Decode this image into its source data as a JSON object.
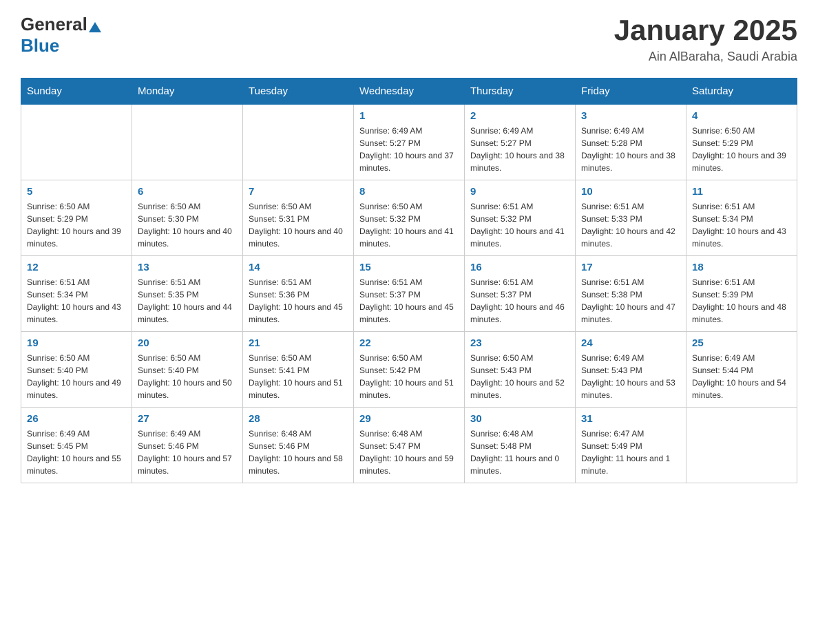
{
  "header": {
    "logo_general": "General",
    "logo_blue": "Blue",
    "month_year": "January 2025",
    "location": "Ain AlBaraha, Saudi Arabia"
  },
  "weekdays": [
    "Sunday",
    "Monday",
    "Tuesday",
    "Wednesday",
    "Thursday",
    "Friday",
    "Saturday"
  ],
  "rows": [
    [
      {
        "day": "",
        "info": ""
      },
      {
        "day": "",
        "info": ""
      },
      {
        "day": "",
        "info": ""
      },
      {
        "day": "1",
        "info": "Sunrise: 6:49 AM\nSunset: 5:27 PM\nDaylight: 10 hours and 37 minutes."
      },
      {
        "day": "2",
        "info": "Sunrise: 6:49 AM\nSunset: 5:27 PM\nDaylight: 10 hours and 38 minutes."
      },
      {
        "day": "3",
        "info": "Sunrise: 6:49 AM\nSunset: 5:28 PM\nDaylight: 10 hours and 38 minutes."
      },
      {
        "day": "4",
        "info": "Sunrise: 6:50 AM\nSunset: 5:29 PM\nDaylight: 10 hours and 39 minutes."
      }
    ],
    [
      {
        "day": "5",
        "info": "Sunrise: 6:50 AM\nSunset: 5:29 PM\nDaylight: 10 hours and 39 minutes."
      },
      {
        "day": "6",
        "info": "Sunrise: 6:50 AM\nSunset: 5:30 PM\nDaylight: 10 hours and 40 minutes."
      },
      {
        "day": "7",
        "info": "Sunrise: 6:50 AM\nSunset: 5:31 PM\nDaylight: 10 hours and 40 minutes."
      },
      {
        "day": "8",
        "info": "Sunrise: 6:50 AM\nSunset: 5:32 PM\nDaylight: 10 hours and 41 minutes."
      },
      {
        "day": "9",
        "info": "Sunrise: 6:51 AM\nSunset: 5:32 PM\nDaylight: 10 hours and 41 minutes."
      },
      {
        "day": "10",
        "info": "Sunrise: 6:51 AM\nSunset: 5:33 PM\nDaylight: 10 hours and 42 minutes."
      },
      {
        "day": "11",
        "info": "Sunrise: 6:51 AM\nSunset: 5:34 PM\nDaylight: 10 hours and 43 minutes."
      }
    ],
    [
      {
        "day": "12",
        "info": "Sunrise: 6:51 AM\nSunset: 5:34 PM\nDaylight: 10 hours and 43 minutes."
      },
      {
        "day": "13",
        "info": "Sunrise: 6:51 AM\nSunset: 5:35 PM\nDaylight: 10 hours and 44 minutes."
      },
      {
        "day": "14",
        "info": "Sunrise: 6:51 AM\nSunset: 5:36 PM\nDaylight: 10 hours and 45 minutes."
      },
      {
        "day": "15",
        "info": "Sunrise: 6:51 AM\nSunset: 5:37 PM\nDaylight: 10 hours and 45 minutes."
      },
      {
        "day": "16",
        "info": "Sunrise: 6:51 AM\nSunset: 5:37 PM\nDaylight: 10 hours and 46 minutes."
      },
      {
        "day": "17",
        "info": "Sunrise: 6:51 AM\nSunset: 5:38 PM\nDaylight: 10 hours and 47 minutes."
      },
      {
        "day": "18",
        "info": "Sunrise: 6:51 AM\nSunset: 5:39 PM\nDaylight: 10 hours and 48 minutes."
      }
    ],
    [
      {
        "day": "19",
        "info": "Sunrise: 6:50 AM\nSunset: 5:40 PM\nDaylight: 10 hours and 49 minutes."
      },
      {
        "day": "20",
        "info": "Sunrise: 6:50 AM\nSunset: 5:40 PM\nDaylight: 10 hours and 50 minutes."
      },
      {
        "day": "21",
        "info": "Sunrise: 6:50 AM\nSunset: 5:41 PM\nDaylight: 10 hours and 51 minutes."
      },
      {
        "day": "22",
        "info": "Sunrise: 6:50 AM\nSunset: 5:42 PM\nDaylight: 10 hours and 51 minutes."
      },
      {
        "day": "23",
        "info": "Sunrise: 6:50 AM\nSunset: 5:43 PM\nDaylight: 10 hours and 52 minutes."
      },
      {
        "day": "24",
        "info": "Sunrise: 6:49 AM\nSunset: 5:43 PM\nDaylight: 10 hours and 53 minutes."
      },
      {
        "day": "25",
        "info": "Sunrise: 6:49 AM\nSunset: 5:44 PM\nDaylight: 10 hours and 54 minutes."
      }
    ],
    [
      {
        "day": "26",
        "info": "Sunrise: 6:49 AM\nSunset: 5:45 PM\nDaylight: 10 hours and 55 minutes."
      },
      {
        "day": "27",
        "info": "Sunrise: 6:49 AM\nSunset: 5:46 PM\nDaylight: 10 hours and 57 minutes."
      },
      {
        "day": "28",
        "info": "Sunrise: 6:48 AM\nSunset: 5:46 PM\nDaylight: 10 hours and 58 minutes."
      },
      {
        "day": "29",
        "info": "Sunrise: 6:48 AM\nSunset: 5:47 PM\nDaylight: 10 hours and 59 minutes."
      },
      {
        "day": "30",
        "info": "Sunrise: 6:48 AM\nSunset: 5:48 PM\nDaylight: 11 hours and 0 minutes."
      },
      {
        "day": "31",
        "info": "Sunrise: 6:47 AM\nSunset: 5:49 PM\nDaylight: 11 hours and 1 minute."
      },
      {
        "day": "",
        "info": ""
      }
    ]
  ]
}
